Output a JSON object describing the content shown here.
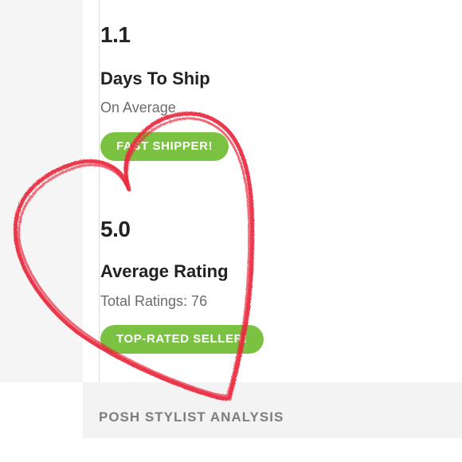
{
  "stats": [
    {
      "value": "1.1",
      "label": "Days To Ship",
      "sub": "On Average",
      "badge": "FAST SHIPPER!"
    },
    {
      "value": "5.0",
      "label": "Average Rating",
      "sub": "Total Ratings: 76",
      "badge": "TOP-RATED SELLER!"
    }
  ],
  "section": {
    "title": "POSH STYLIST ANALYSIS"
  },
  "colors": {
    "badge_green": "#7cc242",
    "heart_red": "#e8283c"
  },
  "overlay_icon": "hand-drawn-heart-icon"
}
